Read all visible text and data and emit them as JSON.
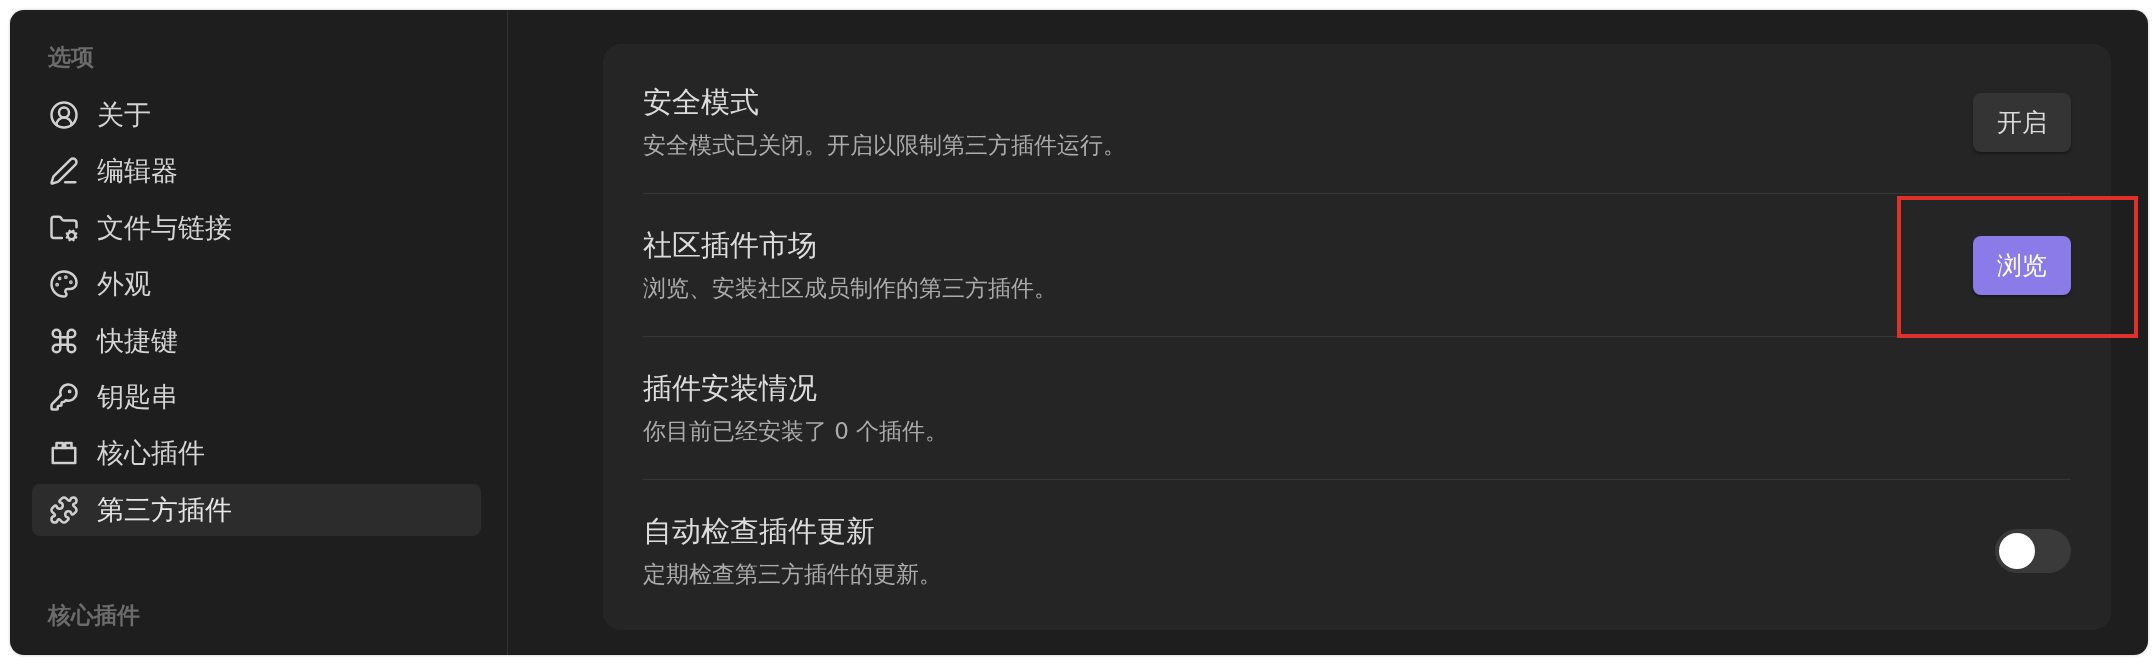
{
  "sidebar": {
    "sections": [
      {
        "heading": "选项",
        "items": [
          {
            "label": "关于",
            "selected": false
          },
          {
            "label": "编辑器",
            "selected": false
          },
          {
            "label": "文件与链接",
            "selected": false
          },
          {
            "label": "外观",
            "selected": false
          },
          {
            "label": "快捷键",
            "selected": false
          },
          {
            "label": "钥匙串",
            "selected": false
          },
          {
            "label": "核心插件",
            "selected": false
          },
          {
            "label": "第三方插件",
            "selected": true
          }
        ]
      },
      {
        "heading": "核心插件"
      }
    ]
  },
  "settings": [
    {
      "title": "安全模式",
      "description": "安全模式已关闭。开启以限制第三方插件运行。",
      "control": {
        "kind": "button",
        "label": "开启",
        "primary": false,
        "highlighted": false
      }
    },
    {
      "title": "社区插件市场",
      "description": "浏览、安装社区成员制作的第三方插件。",
      "control": {
        "kind": "button",
        "label": "浏览",
        "primary": true,
        "highlighted": true
      }
    },
    {
      "title": "插件安装情况",
      "description": "你目前已经安装了 0 个插件。"
    },
    {
      "title": "自动检查插件更新",
      "description": "定期检查第三方插件的更新。",
      "control": {
        "kind": "toggle",
        "on": false
      }
    }
  ]
}
